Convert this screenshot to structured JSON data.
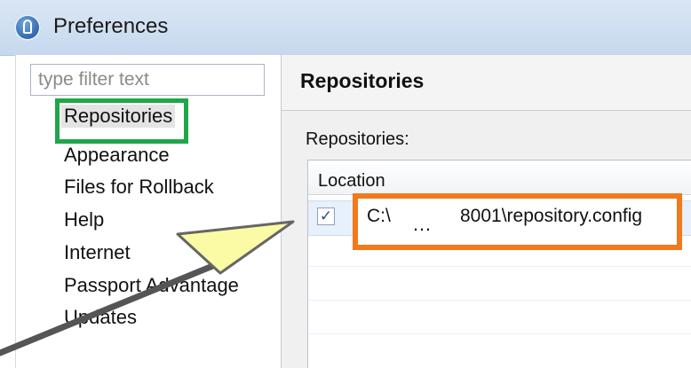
{
  "window": {
    "title": "Preferences",
    "icon": "app-icon"
  },
  "sidebar": {
    "filter_placeholder": "type filter text",
    "items": [
      {
        "label": "Repositories",
        "selected": true
      },
      {
        "label": "Appearance"
      },
      {
        "label": "Files for Rollback"
      },
      {
        "label": "Help"
      },
      {
        "label": "Internet"
      },
      {
        "label": "Passport Advantage"
      },
      {
        "label": "Updates"
      }
    ]
  },
  "main": {
    "page_title": "Repositories",
    "section_label": "Repositories:",
    "table": {
      "columns": [
        "Location"
      ],
      "rows": [
        {
          "checked": true,
          "check_glyph": "✓",
          "location_start": "C:\\",
          "location_ellipsis": "…",
          "location_end": "8001\\repository.config"
        }
      ]
    }
  },
  "highlights": {
    "green_box_color": "#1fa64a",
    "orange_box_color": "#f07a1c",
    "callout_fill": "#fbfba6"
  }
}
